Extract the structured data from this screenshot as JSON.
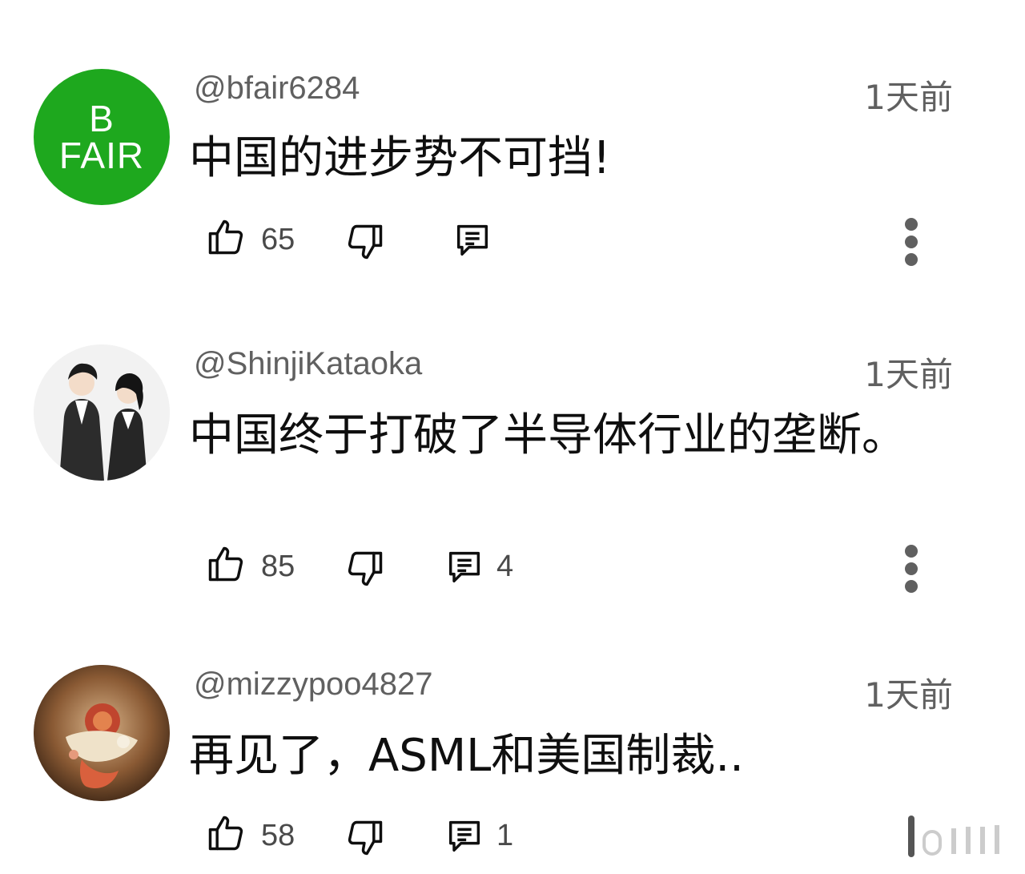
{
  "comments": [
    {
      "avatar_initials": [
        "B",
        "FAIR"
      ],
      "avatar_color": "#1ea81e",
      "username": "@bfair6284",
      "time": "1天前",
      "text": "中国的进步势不可挡!",
      "likes": "65",
      "replies": ""
    },
    {
      "avatar_icon": "anime-couple-avatar",
      "username": "@ShinjiKataoka",
      "time": "1天前",
      "text": "中国终于打破了半导体行业的垄断。",
      "likes": "85",
      "replies": "4"
    },
    {
      "avatar_icon": "illustrated-character-avatar",
      "username": "@mizzypoo4827",
      "time": "1天前",
      "text": "再见了，ASML和美国制裁..",
      "likes": "58",
      "replies": "1"
    }
  ],
  "icons": {
    "like": "thumbs-up-icon",
    "dislike": "thumbs-down-icon",
    "reply": "comment-icon",
    "more": "more-vertical-icon"
  }
}
